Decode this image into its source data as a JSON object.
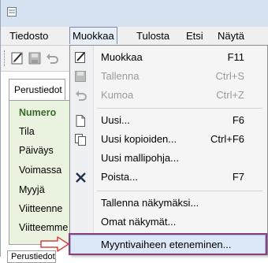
{
  "menubar": {
    "items": [
      {
        "label": "Tiedosto"
      },
      {
        "label": "Muokkaa"
      },
      {
        "label": "Tulosta"
      },
      {
        "label": "Etsi"
      },
      {
        "label": "Näytä"
      }
    ]
  },
  "form": {
    "tab_label": "Perustiedot",
    "bottom_tab_label": "Perustiedot",
    "fields": [
      {
        "label": "Numero"
      },
      {
        "label": "Tila"
      },
      {
        "label": "Päiväys"
      },
      {
        "label": "Voimassa"
      },
      {
        "label": "Myyjä"
      },
      {
        "label": "Viitteenne"
      },
      {
        "label": "Viitteemme"
      }
    ]
  },
  "dropdown": {
    "items": [
      {
        "label": "Muokkaa",
        "shortcut": "F11",
        "icon": "edit-icon",
        "enabled": true
      },
      {
        "label": "Tallenna",
        "shortcut": "Ctrl+S",
        "icon": "save-icon",
        "enabled": false
      },
      {
        "label": "Kumoa",
        "shortcut": "Ctrl+Z",
        "icon": "undo-icon",
        "enabled": false
      },
      {
        "label": "Uusi...",
        "shortcut": "F6",
        "icon": "new-document-icon",
        "enabled": true
      },
      {
        "label": "Uusi kopioiden...",
        "shortcut": "Ctrl+F6",
        "icon": "copy-document-icon",
        "enabled": true
      },
      {
        "label": "Uusi mallipohja...",
        "shortcut": "",
        "icon": "",
        "enabled": true
      },
      {
        "label": "Poista...",
        "shortcut": "F7",
        "icon": "delete-icon",
        "enabled": true
      },
      {
        "label": "Tallenna näkymäksi...",
        "shortcut": "",
        "icon": "",
        "enabled": true
      },
      {
        "label": "Omat näkymät...",
        "shortcut": "",
        "icon": "",
        "enabled": true
      },
      {
        "label": "Myyntivaiheen eteneminen...",
        "shortcut": "",
        "icon": "",
        "enabled": true,
        "highlighted": true
      }
    ]
  },
  "colors": {
    "annotation_frame": "#8a3e7a",
    "annotation_arrow": "#d9443a",
    "form_panel": "#e9f3df",
    "field_bold": "#3a6a2a"
  }
}
